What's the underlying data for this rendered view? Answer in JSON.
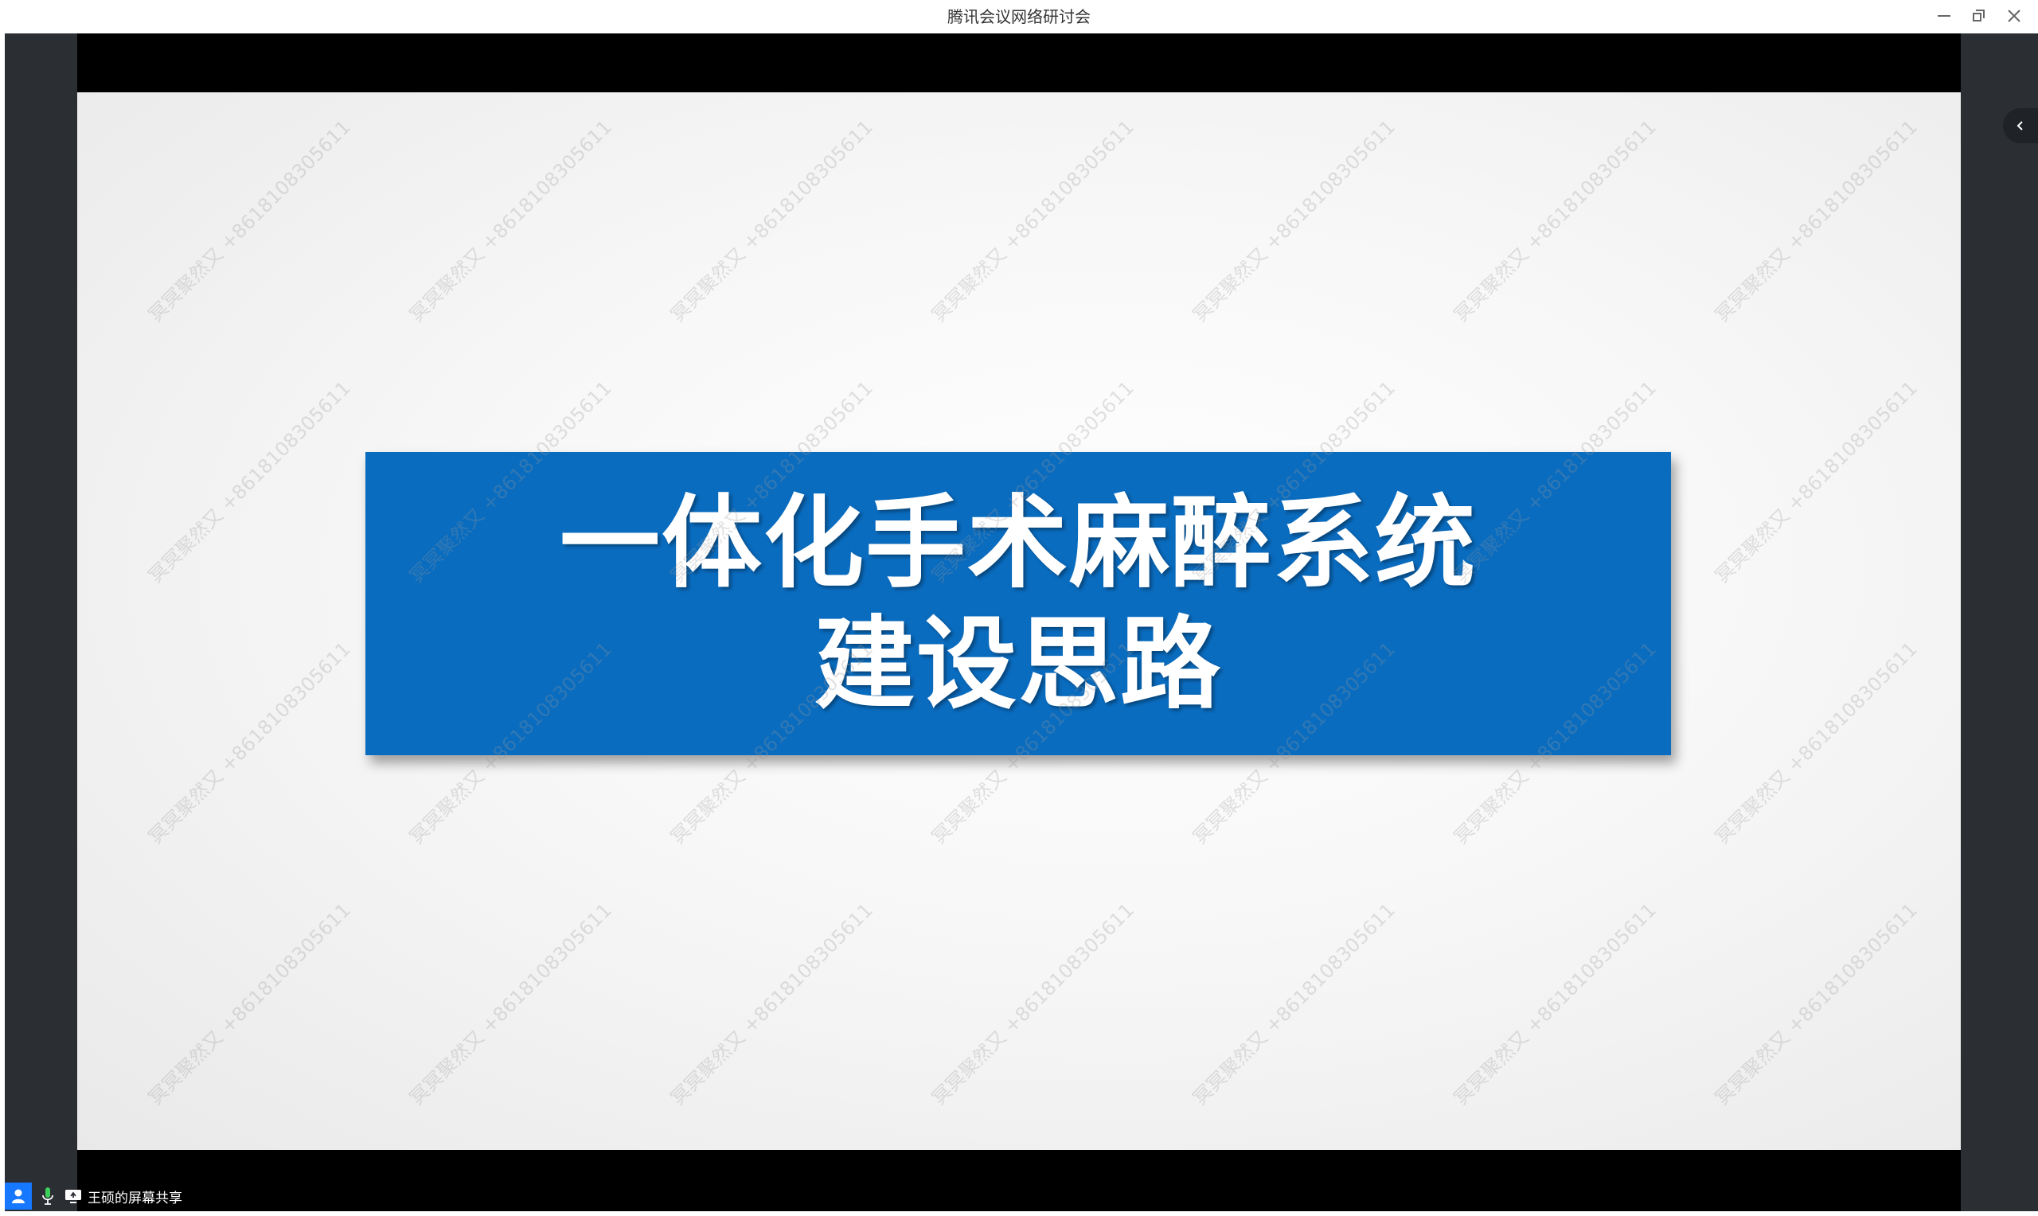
{
  "window": {
    "title": "腾讯会议网络研讨会",
    "icons": {
      "minimize": "minimize-icon",
      "restore": "restore-icon",
      "close": "close-icon"
    }
  },
  "slide": {
    "title_line1": "一体化手术麻醉系统",
    "title_line2": "建设思路",
    "banner_color": "#0a6cbf",
    "watermark_text": "冥冥聚然又 +8618108305611"
  },
  "side_panel": {
    "toggle_icon": "chevron-left-icon"
  },
  "status": {
    "share_label": "王硕的屏幕共享",
    "icons": [
      "user-icon",
      "microphone-icon",
      "screen-share-icon"
    ]
  }
}
